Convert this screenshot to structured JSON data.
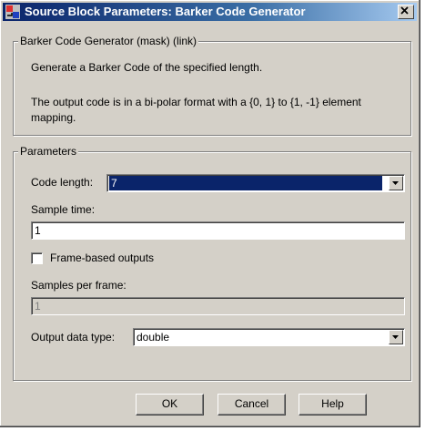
{
  "window": {
    "title": "Source Block Parameters: Barker Code Generator",
    "icon": "simulink-block-icon",
    "close_icon": "close-icon"
  },
  "description_group": {
    "legend": "Barker Code Generator (mask) (link)",
    "line1": "Generate a Barker Code of the specified length.",
    "line2": "The output code is in a bi-polar format with a {0, 1} to {1, -1} element",
    "line3": "mapping."
  },
  "parameters_group": {
    "legend": "Parameters",
    "code_length_label": "Code length:",
    "code_length_value": "7",
    "sample_time_label": "Sample time:",
    "sample_time_value": "1",
    "frame_based_label": "Frame-based outputs",
    "frame_based_checked": false,
    "samples_per_frame_label": "Samples per frame:",
    "samples_per_frame_value": "1",
    "output_type_label": "Output data type:",
    "output_type_value": "double"
  },
  "buttons": {
    "ok": "OK",
    "cancel": "Cancel",
    "help": "Help"
  },
  "colors": {
    "title_active": "#0a246a",
    "face": "#d4d0c8",
    "selection": "#0a246a"
  }
}
